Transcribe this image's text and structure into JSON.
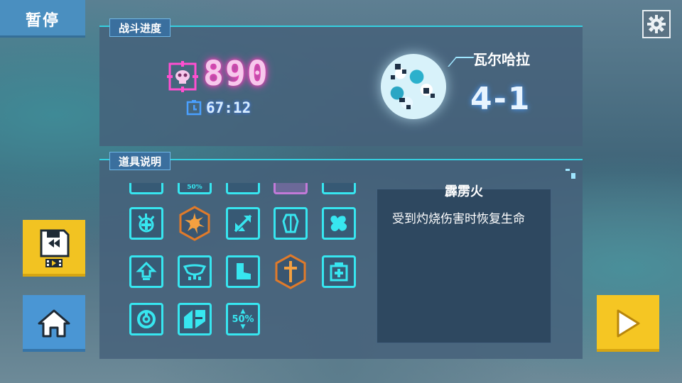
{
  "pause_title": "暂停",
  "battle_progress": {
    "section_label": "战斗进度",
    "score": "890",
    "time": "67:12",
    "zone_name": "瓦尔哈拉",
    "level": "4-1"
  },
  "item_info": {
    "section_label": "道具说明",
    "selected_item_name": "霹雳火",
    "selected_item_desc": "受到灼烧伤害时恢复生命",
    "item_labels": {
      "percent_partial": "50%",
      "percent_full": "50%"
    }
  },
  "colors": {
    "item_border": "#37e6f0",
    "hex_item": "#e07a2a",
    "score_glow": "#ff40c0",
    "accent_yellow": "#f2c322",
    "accent_blue": "#4a96d4"
  },
  "icons": [
    "gear-icon",
    "score-skull-icon",
    "timer-icon",
    "rewind-save-icon",
    "home-icon",
    "play-icon"
  ]
}
